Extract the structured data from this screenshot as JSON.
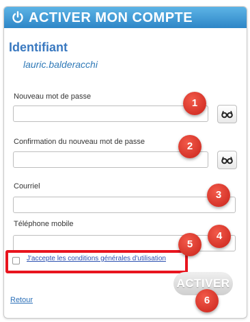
{
  "header": {
    "title": "ACTIVER MON COMPTE",
    "icon": "power-icon"
  },
  "identifiant": {
    "label": "Identifiant",
    "value": "lauric.balderacchi"
  },
  "fields": {
    "new_password": {
      "label": "Nouveau mot de passe",
      "value": ""
    },
    "confirm_password": {
      "label": "Confirmation du nouveau mot de passe",
      "value": ""
    },
    "email": {
      "label": "Courriel",
      "value": ""
    },
    "phone": {
      "label": "Téléphone mobile",
      "value": ""
    }
  },
  "terms": {
    "label": "J'accepte les conditions générales d'utilisation",
    "checked": false
  },
  "buttons": {
    "submit": "ACTIVER",
    "back": "Retour"
  },
  "badges": [
    "1",
    "2",
    "3",
    "4",
    "5",
    "6"
  ],
  "colors": {
    "header": "#2e86c7",
    "badge": "#d8302a",
    "highlight": "#e8141e"
  }
}
